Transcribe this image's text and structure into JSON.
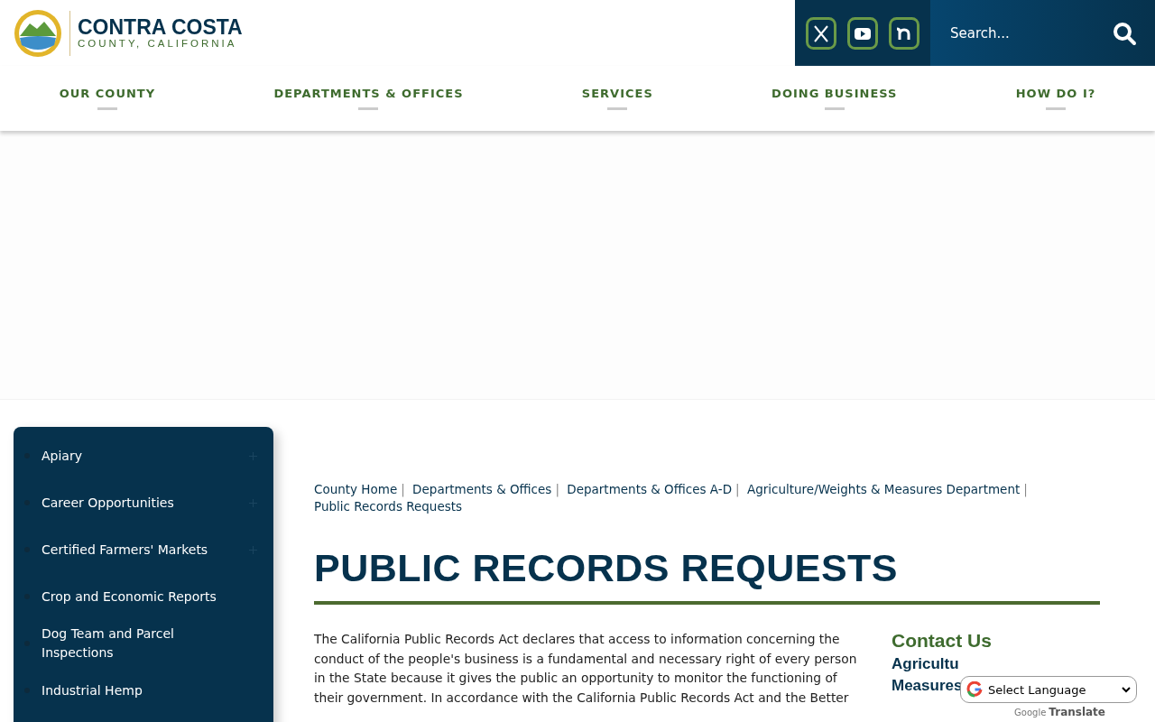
{
  "logo": {
    "title": "CONTRA COSTA",
    "subtitle": "COUNTY, CALIFORNIA"
  },
  "social": [
    {
      "kind": "x"
    },
    {
      "kind": "youtube"
    },
    {
      "kind": "nextdoor"
    }
  ],
  "search": {
    "placeholder": "Search..."
  },
  "nav": [
    "OUR COUNTY",
    "DEPARTMENTS & OFFICES",
    "SERVICES",
    "DOING BUSINESS",
    "HOW DO I?"
  ],
  "sidebar": {
    "items": [
      {
        "label": "Apiary",
        "expandable": true
      },
      {
        "label": "Career Opportunities",
        "expandable": true
      },
      {
        "label": "Certified Farmers' Markets",
        "expandable": true
      },
      {
        "label": "Crop and Economic Reports",
        "expandable": false
      },
      {
        "label": "Dog Team and Parcel Inspections",
        "expandable": false
      },
      {
        "label": "Industrial Hemp",
        "expandable": false
      }
    ]
  },
  "breadcrumb": {
    "separator": "|",
    "links": [
      "County Home",
      "Departments & Offices",
      "Departments & Offices A-D",
      "Agriculture/Weights & Measures Department",
      "Public Records Requests"
    ]
  },
  "page_title": "PUBLIC RECORDS REQUESTS",
  "body": "The California Public Records Act declares that access to information concerning the conduct of the people's business is a fundamental and necessary right of every person in the State because it gives the public an opportunity to monitor the functioning of their government. In accordance with the California Public Records Act and the Better",
  "contact": {
    "heading": "Contact Us",
    "department_lines": [
      "Agricultu",
      "Measures"
    ]
  },
  "translate": {
    "select": "Select Language",
    "powered_brand": "Google",
    "powered_label": "Translate"
  }
}
